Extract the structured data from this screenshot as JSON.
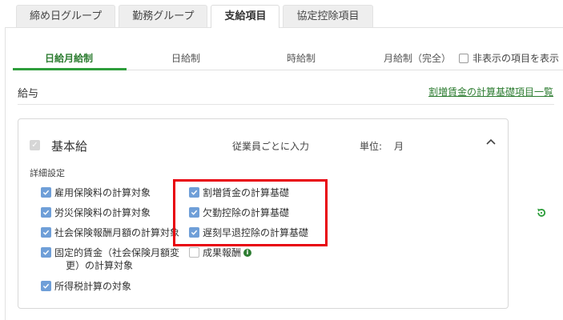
{
  "top_tabs": [
    {
      "label": "締め日グループ",
      "active": false
    },
    {
      "label": "勤務グループ",
      "active": false
    },
    {
      "label": "支給項目",
      "active": true
    },
    {
      "label": "協定控除項目",
      "active": false
    }
  ],
  "sub_tabs": [
    {
      "label": "日給月給制",
      "active": true
    },
    {
      "label": "日給制",
      "active": false
    },
    {
      "label": "時給制",
      "active": false
    },
    {
      "label": "月給制（完全）",
      "active": false
    }
  ],
  "hidden_toggle": {
    "label": "非表示の項目を表示",
    "checked": false
  },
  "section": {
    "title": "給与",
    "link": "割増賃金の計算基礎項目一覧"
  },
  "item": {
    "name": "基本給",
    "input_mode": "従業員ごとに入力",
    "unit_label": "単位:",
    "unit_value": "月",
    "detail_label": "詳細設定",
    "left_options": [
      {
        "label": "雇用保険料の計算対象",
        "checked": true
      },
      {
        "label": "労災保険料の計算対象",
        "checked": true
      },
      {
        "label": "社会保険報酬月額の計算対象",
        "checked": true
      },
      {
        "label_line1": "固定的賃金（社会保険月額変",
        "label_line2": "更）の計算対象",
        "checked": true
      },
      {
        "label": "所得税計算の対象",
        "checked": true
      }
    ],
    "right_options": [
      {
        "label": "割増賃金の計算基礎",
        "checked": true
      },
      {
        "label": "欠勤控除の計算基礎",
        "checked": true
      },
      {
        "label": "遅刻早退控除の計算基礎",
        "checked": true
      },
      {
        "label": "成果報酬",
        "checked": false
      }
    ]
  },
  "colors": {
    "accent_green": "#2e7d32",
    "checkbox_blue": "#6f9fd8",
    "highlight_red": "#e8000b"
  }
}
